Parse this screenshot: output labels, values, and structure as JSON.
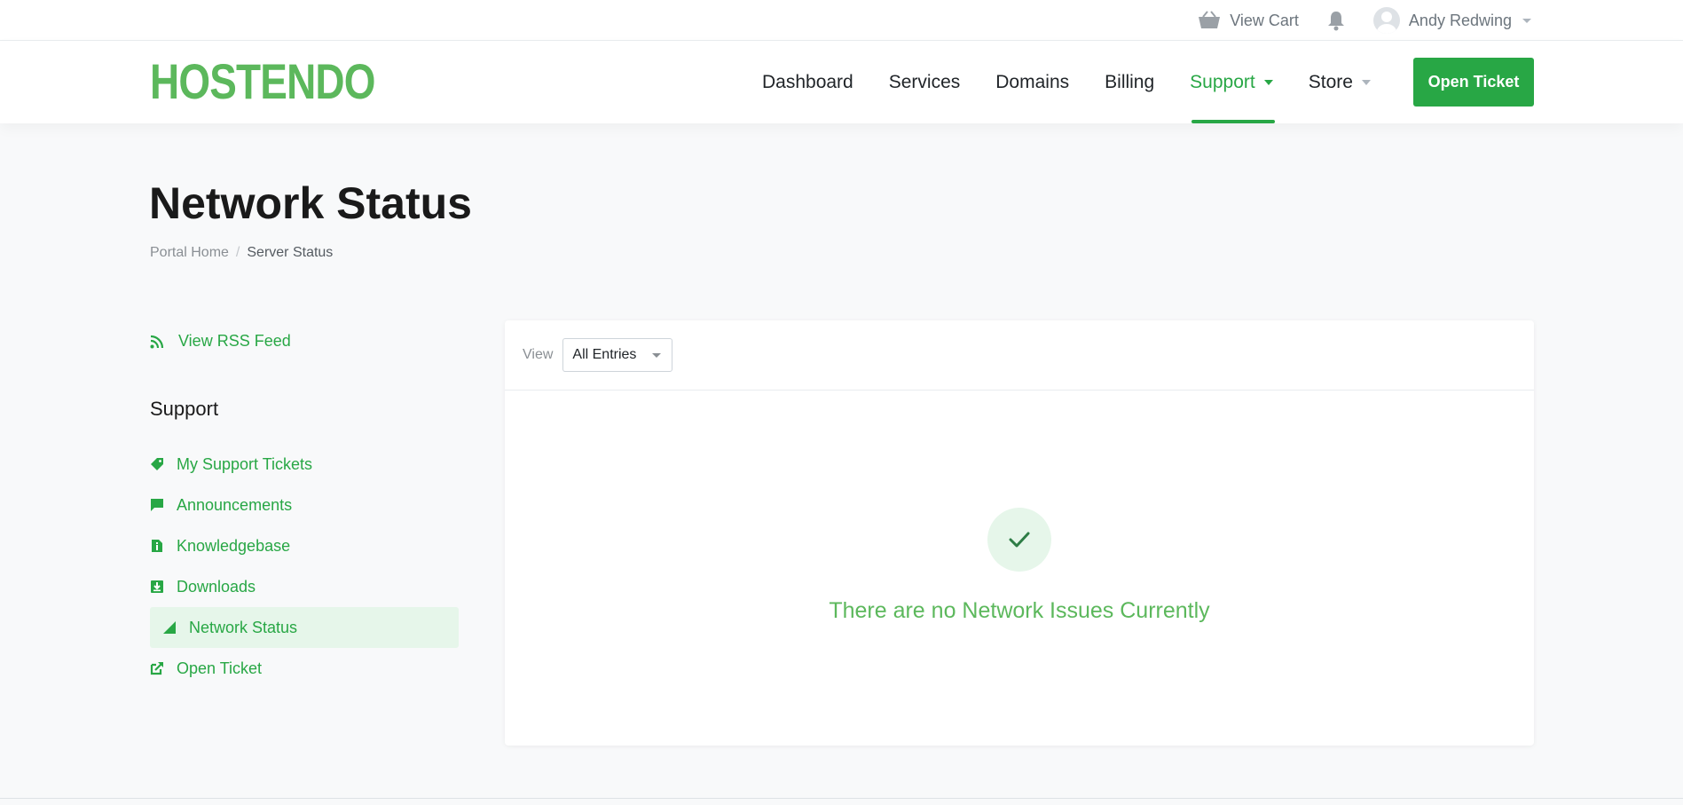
{
  "topbar": {
    "cart_label": "View Cart",
    "user_name": "Andy Redwing"
  },
  "brand": {
    "logo_text": "HOSTENDO",
    "accent_color": "#28a745",
    "logo_color": "#5cb85c"
  },
  "nav": {
    "items": [
      {
        "label": "Dashboard"
      },
      {
        "label": "Services"
      },
      {
        "label": "Domains"
      },
      {
        "label": "Billing"
      },
      {
        "label": "Support",
        "active": true,
        "dropdown": true
      },
      {
        "label": "Store",
        "dropdown": true
      }
    ],
    "cta_label": "Open Ticket"
  },
  "page": {
    "title": "Network Status",
    "breadcrumb": [
      {
        "label": "Portal Home"
      },
      {
        "label": "Server Status",
        "current": true
      }
    ]
  },
  "sidebar": {
    "rss_label": "View RSS Feed",
    "heading": "Support",
    "items": [
      {
        "label": "My Support Tickets",
        "icon": "ticket-icon"
      },
      {
        "label": "Announcements",
        "icon": "comment-icon"
      },
      {
        "label": "Knowledgebase",
        "icon": "file-info-icon"
      },
      {
        "label": "Downloads",
        "icon": "download-icon"
      },
      {
        "label": "Network Status",
        "icon": "signal-icon",
        "active": true
      },
      {
        "label": "Open Ticket",
        "icon": "external-link-icon"
      }
    ]
  },
  "filter": {
    "view_label": "View",
    "selected": "All Entries"
  },
  "status": {
    "message": "There are no Network Issues Currently"
  }
}
